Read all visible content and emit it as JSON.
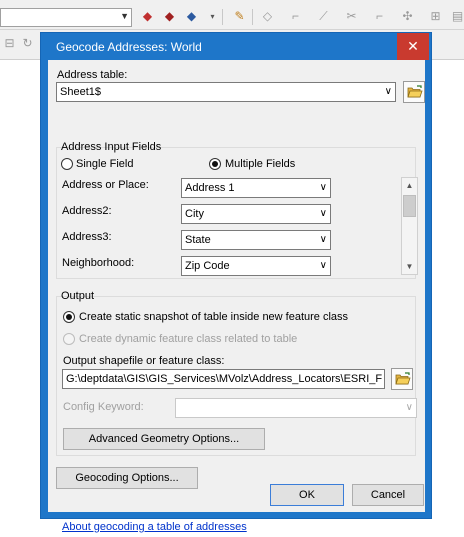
{
  "window": {
    "title": "Geocode Addresses:  World",
    "close_glyph": "✕"
  },
  "address_table": {
    "label": "Address table:",
    "value": "Sheet1$"
  },
  "input_fields": {
    "group_title": "Address Input Fields",
    "single_field_label": "Single Field",
    "multiple_fields_label": "Multiple Fields",
    "selected_mode": "Multiple Fields",
    "rows": [
      {
        "label": "Address or Place:",
        "value": "Address 1"
      },
      {
        "label": "Address2:",
        "value": "City"
      },
      {
        "label": "Address3:",
        "value": "State"
      },
      {
        "label": "Neighborhood:",
        "value": "Zip Code"
      }
    ]
  },
  "output": {
    "group_title": "Output",
    "static_label": "Create static snapshot of table inside new feature class",
    "dynamic_label": "Create dynamic feature class related to table",
    "selected": "static",
    "shapefile_label": "Output shapefile or feature class:",
    "shapefile_value": "G:\\deptdata\\GIS\\GIS_Services\\MVolz\\Address_Locators\\ESRI_F",
    "config_keyword_label": "Config Keyword:",
    "config_keyword_value": "",
    "advanced_geometry_button": "Advanced Geometry Options..."
  },
  "geocoding_options_button": "Geocoding Options...",
  "help_link": "About geocoding a table of addresses",
  "ok_button": "OK",
  "cancel_button": "Cancel",
  "colors": {
    "title_bar": "#1e76c9",
    "close_button": "#c93a2f",
    "link": "#0033cc"
  }
}
